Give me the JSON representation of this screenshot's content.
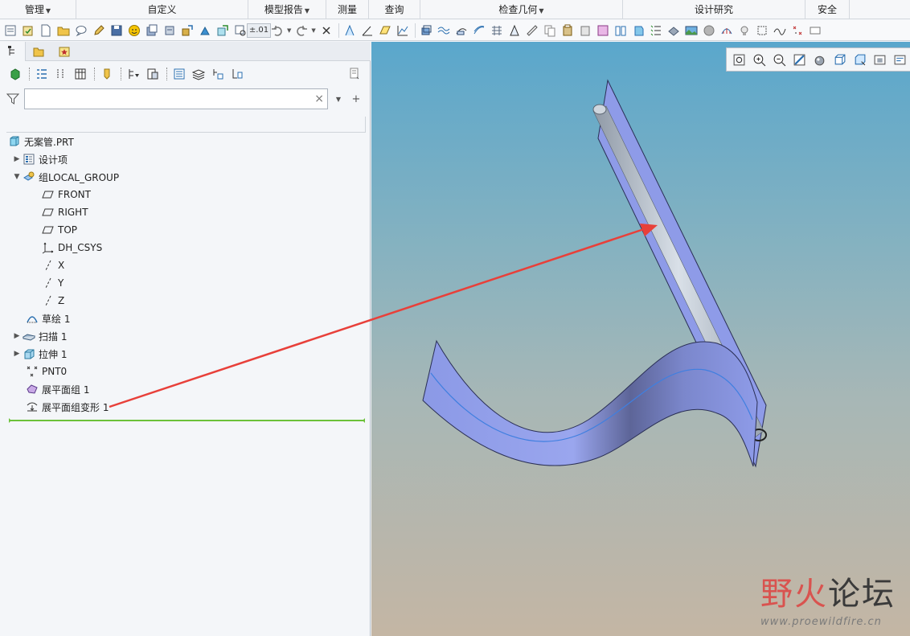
{
  "ribbon_groups": [
    {
      "label": "管理",
      "dropdown": true
    },
    {
      "label": "自定义",
      "dropdown": false
    },
    {
      "label": "模型报告",
      "dropdown": true
    },
    {
      "label": "测量",
      "dropdown": false
    },
    {
      "label": "查询",
      "dropdown": false
    },
    {
      "label": "检查几何",
      "dropdown": true
    },
    {
      "label": "设计研究",
      "dropdown": false
    },
    {
      "label": "安全",
      "dropdown": false
    }
  ],
  "toolbar": {
    "precision_label": "±.01"
  },
  "filter": {
    "value": "",
    "clear_glyph": "×",
    "add_glyph": "+"
  },
  "tree": {
    "root": "无案管.PRT",
    "items": [
      {
        "label": "设计项",
        "icon": "design-items-icon",
        "expandable": true,
        "expanded": false,
        "indent": 1
      },
      {
        "label": "组LOCAL_GROUP",
        "icon": "group-icon",
        "expandable": true,
        "expanded": true,
        "indent": 1
      },
      {
        "label": "FRONT",
        "icon": "datum-plane-icon",
        "expandable": false,
        "indent": 2
      },
      {
        "label": "RIGHT",
        "icon": "datum-plane-icon",
        "expandable": false,
        "indent": 2
      },
      {
        "label": "TOP",
        "icon": "datum-plane-icon",
        "expandable": false,
        "indent": 2
      },
      {
        "label": "DH_CSYS",
        "icon": "coordinate-system-icon",
        "expandable": false,
        "indent": 2
      },
      {
        "label": "X",
        "icon": "datum-axis-icon",
        "expandable": false,
        "indent": 2
      },
      {
        "label": "Y",
        "icon": "datum-axis-icon",
        "expandable": false,
        "indent": 2
      },
      {
        "label": "Z",
        "icon": "datum-axis-icon",
        "expandable": false,
        "indent": 2
      },
      {
        "label": "草绘 1",
        "icon": "sketch-icon",
        "expandable": false,
        "indent": 1
      },
      {
        "label": "扫描 1",
        "icon": "sweep-icon",
        "expandable": true,
        "expanded": false,
        "indent": 1
      },
      {
        "label": "拉伸 1",
        "icon": "extrude-icon",
        "expandable": true,
        "expanded": false,
        "indent": 1
      },
      {
        "label": "PNT0",
        "icon": "datum-point-icon",
        "expandable": false,
        "indent": 1
      },
      {
        "label": "展平面组 1",
        "icon": "flatten-quilt-icon",
        "expandable": false,
        "indent": 1
      },
      {
        "label": "展平面组变形 1",
        "icon": "flatten-quilt-deform-icon",
        "expandable": false,
        "indent": 1
      }
    ]
  },
  "watermark": {
    "title_red": "野火",
    "title_dark": "论坛",
    "url": "www.proewildfire.cn"
  },
  "colors": {
    "accent_red": "#e8403a",
    "quilt_fill": "#8e9be8",
    "tube_fill": "#b9c2cc",
    "insert_line": "#6cc13a"
  }
}
